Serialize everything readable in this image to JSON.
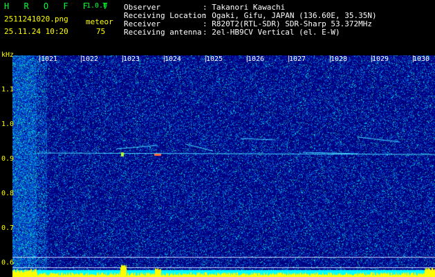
{
  "header": {
    "logo": "H R O F F T",
    "version": "1.0.0",
    "filename": "2511241020.png",
    "datetime": "25.11.24 10:20",
    "meteor_label": "meteor",
    "meteor_count": "75",
    "observer_label": "Observer",
    "observer_value": ": Takanori Kawachi",
    "location_label": "Receiving Location",
    "location_value": ": Ogaki, Gifu, JAPAN (136.60E, 35.35N)",
    "receiver_label": "Receiver",
    "receiver_value": ": R820T2(RTL-SDR) SDR-Sharp 53.372MHz",
    "antenna_label": "Receiving antenna",
    "antenna_value": ": 2el-HB9CV Vertical (el. E-W)"
  },
  "axis": {
    "unit": "kHz",
    "y_ticks": [
      "1.1",
      "1.0",
      "0.9",
      "0.8",
      "0.7",
      "0.6"
    ],
    "x_ticks": [
      "1021",
      "1022",
      "1023",
      "1024",
      "1025",
      "1026",
      "1027",
      "1028",
      "1029",
      "1030"
    ]
  },
  "colors": {
    "background": "#000000",
    "spectrum_noise": "#00008c",
    "signal": "#4ad9ff",
    "meter": "#ffff00",
    "axis_text": "#ffff00"
  }
}
